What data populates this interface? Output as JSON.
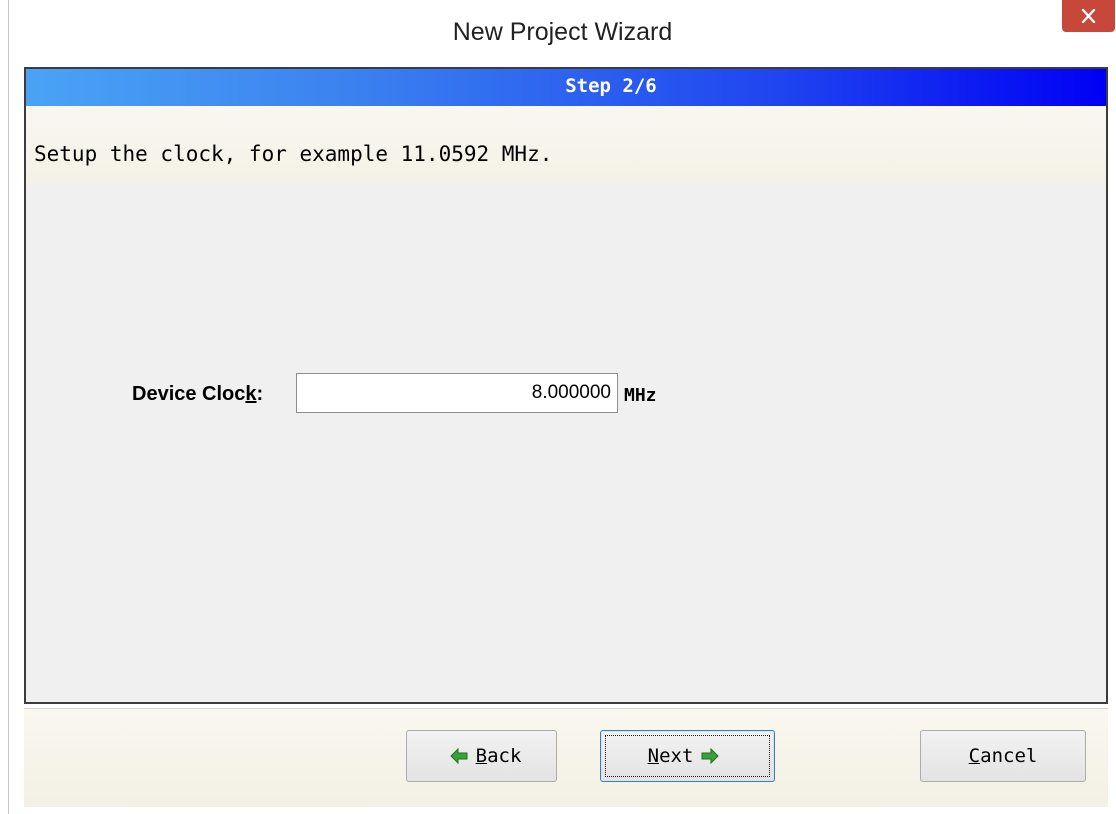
{
  "window": {
    "title": "New Project Wizard"
  },
  "wizard": {
    "step_label": "Step 2/6",
    "instruction": "Setup the clock, for example 11.0592 MHz."
  },
  "clock": {
    "label_prefix": "Device Cloc",
    "label_mnemonic": "k",
    "label_suffix": ":",
    "value": "8.000000",
    "unit": "MHz"
  },
  "buttons": {
    "back": {
      "mnemonic": "B",
      "rest": "ack"
    },
    "next": {
      "mnemonic": "N",
      "rest": "ext"
    },
    "cancel": {
      "mnemonic": "C",
      "rest": "ancel"
    }
  },
  "icons": {
    "close": "close-icon",
    "back_arrow": "arrow-left-icon",
    "next_arrow": "arrow-right-icon"
  },
  "colors": {
    "arrow_green": "#3aa13a",
    "close_red": "#c7483b",
    "banner_end": "#0000f4"
  }
}
